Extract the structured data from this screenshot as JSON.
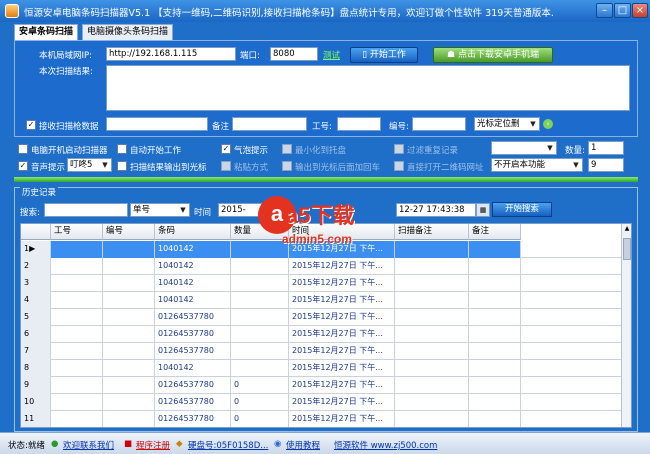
{
  "window": {
    "title": "恒源安卓电脑条码扫描器V5.1 【支持一维码,二维码识别,接收扫描枪条码】盘点统计专用，欢迎订做个性软件 319天普通版本.",
    "min": "–",
    "max": "□",
    "close": "×"
  },
  "tabs": [
    {
      "label": "安卓条码扫描"
    },
    {
      "label": "电脑摄像头条码扫描"
    }
  ],
  "top": {
    "ip_label": "本机局域网IP:",
    "ip_value": "http://192.168.1.115",
    "port_label": "端口:",
    "port_value": "8080",
    "test_label": "测试",
    "start_label": "开始工作",
    "download_label": "点击下载安卓手机端",
    "result_label": "本次扫描结果:",
    "scanner_label": "接收扫描枪数据",
    "remark_label": "备注",
    "worker_label": "工号:",
    "number_label": "编号:",
    "cursor_select": "光标定位删"
  },
  "options": {
    "autostart_label": "电脑开机启动扫描器",
    "autowork_label": "自动开始工作",
    "bubble_label": "气泡提示",
    "tray_label": "最小化到托盘",
    "filter_label": "过滤重复记录",
    "qty_label": "数量:",
    "qty_value": "1",
    "sound_label": "音声提示",
    "sound_select": "叮咚5",
    "output_label": "扫描结果输出到光标",
    "paste_label": "粘贴方式",
    "enter_label": "输出到光标后面加回车",
    "openqr_label": "直接打开二维码网址",
    "qr_select": "不开启本功能",
    "qr_value": "9"
  },
  "history": {
    "title": "历史记录",
    "search_label": "搜索:",
    "field_select": "单号",
    "time_label": "时间",
    "date_from": "2015-",
    "date_to": "12-27 17:43:38",
    "search_btn": "开始搜索"
  },
  "grid": {
    "columns": [
      "",
      "工号",
      "编号",
      "条码",
      "数量",
      "时间",
      "扫描备注",
      "备注"
    ],
    "rows": [
      {
        "n": "1▶",
        "code": "1040142",
        "qty": "",
        "time": "2015年12月27日  下午..."
      },
      {
        "n": "2",
        "code": "1040142",
        "qty": "",
        "time": "2015年12月27日  下午..."
      },
      {
        "n": "3",
        "code": "1040142",
        "qty": "",
        "time": "2015年12月27日  下午..."
      },
      {
        "n": "4",
        "code": "1040142",
        "qty": "",
        "time": "2015年12月27日  下午..."
      },
      {
        "n": "5",
        "code": "01264537780",
        "qty": "",
        "time": "2015年12月27日  下午..."
      },
      {
        "n": "6",
        "code": "01264537780",
        "qty": "",
        "time": "2015年12月27日  下午..."
      },
      {
        "n": "7",
        "code": "01264537780",
        "qty": "",
        "time": "2015年12月27日  下午..."
      },
      {
        "n": "8",
        "code": "1040142",
        "qty": "",
        "time": "2015年12月27日  下午..."
      },
      {
        "n": "9",
        "code": "01264537780",
        "qty": "0",
        "time": "2015年12月27日  下午..."
      },
      {
        "n": "10",
        "code": "01264537780",
        "qty": "0",
        "time": "2015年12月27日  下午..."
      },
      {
        "n": "11",
        "code": "01264537780",
        "qty": "0",
        "time": "2015年12月27日  下午..."
      }
    ]
  },
  "status": {
    "state": "状态:就绪",
    "contact": "欢迎联系我们",
    "register": "程序注册",
    "disk": "硬盘号:05F0158D...",
    "help": "使用教程",
    "site": "恒源软件 www.zj500.com"
  },
  "watermark": {
    "logo": "a5下载",
    "url": "admin5.com"
  },
  "colors": {
    "accent": "#1d6ccd",
    "selected_row": "#3c8ff0",
    "green": "#4a9a28"
  }
}
